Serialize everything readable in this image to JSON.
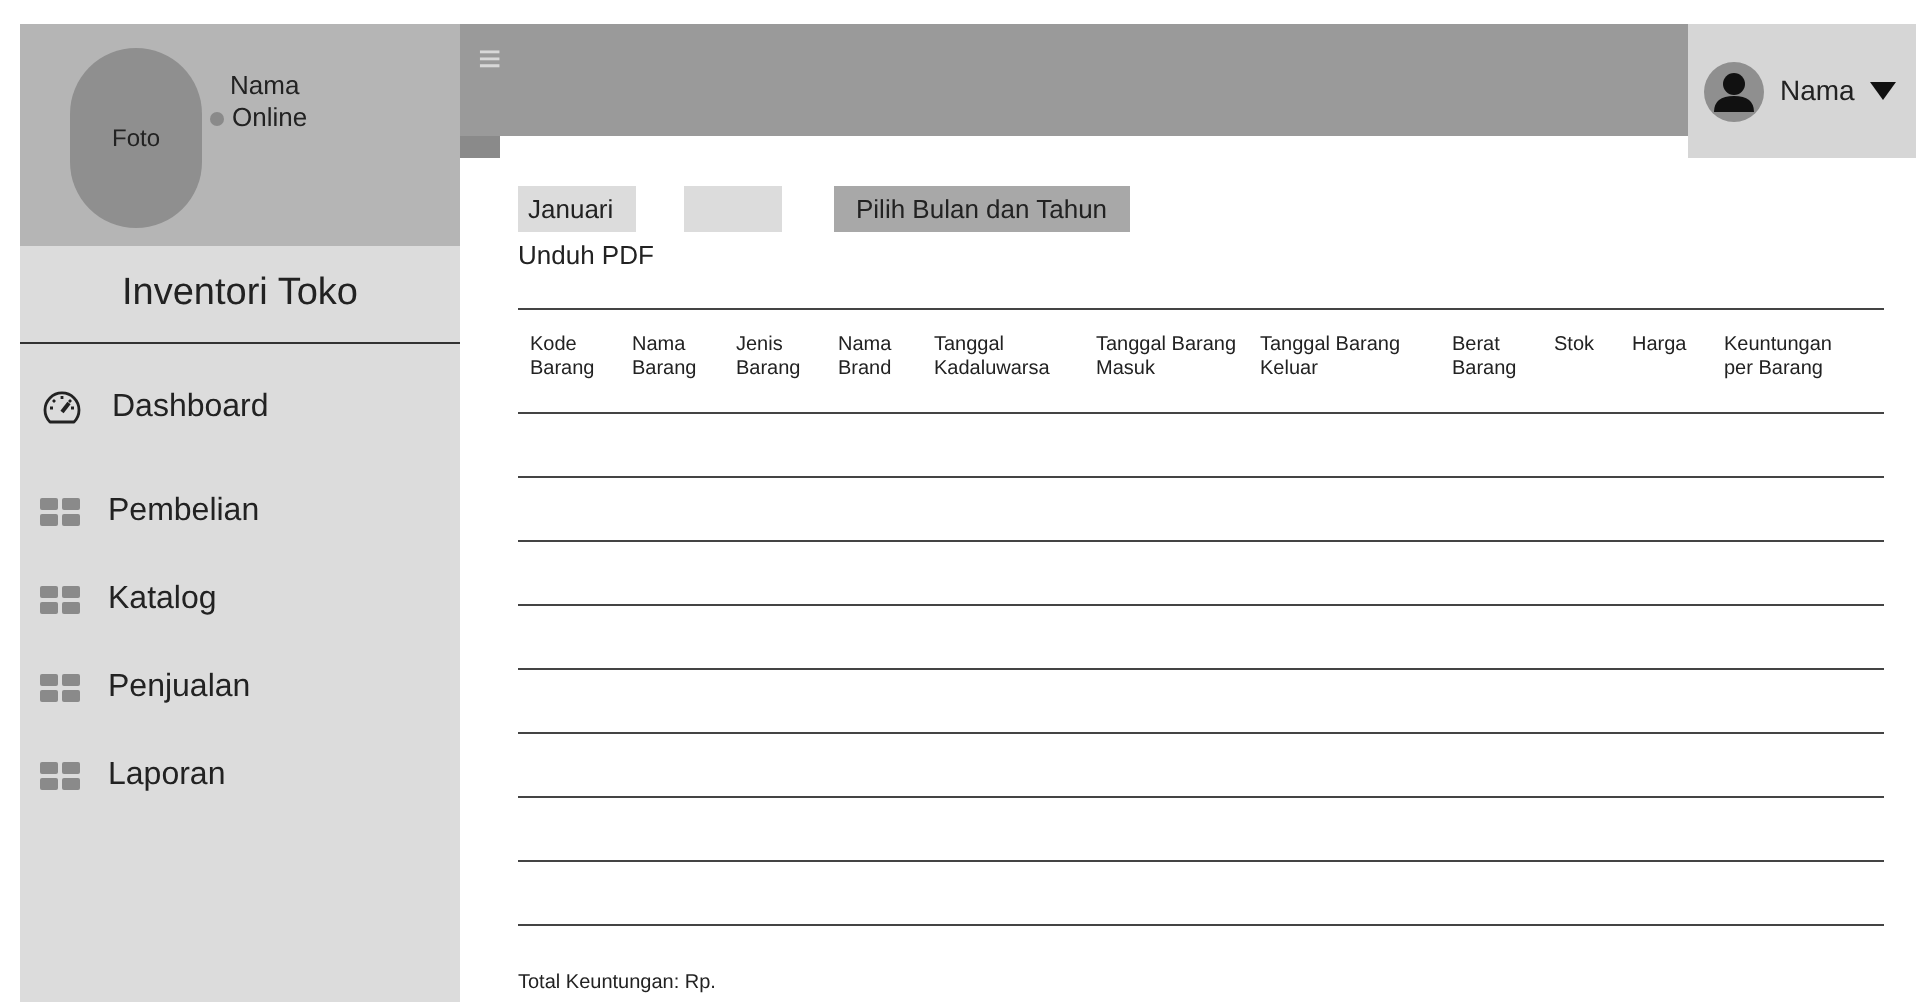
{
  "profile": {
    "photo_label": "Foto",
    "name": "Nama",
    "status": "Online"
  },
  "app_title": "Inventori Toko",
  "sidebar": {
    "items": [
      {
        "label": "Dashboard",
        "kind": "gauge"
      },
      {
        "label": "Pembelian",
        "kind": "grid"
      },
      {
        "label": "Katalog",
        "kind": "grid"
      },
      {
        "label": "Penjualan",
        "kind": "grid"
      },
      {
        "label": "Laporan",
        "kind": "grid"
      }
    ]
  },
  "topbar": {
    "menu_icon": "≡",
    "user_name": "Nama"
  },
  "filters": {
    "month": "Januari",
    "submit": "Pilih Bulan dan Tahun",
    "download": "Unduh PDF"
  },
  "table": {
    "columns": [
      [
        "Kode",
        "Barang"
      ],
      [
        "Nama",
        "Barang"
      ],
      [
        "Jenis",
        "Barang"
      ],
      [
        "Nama",
        "Brand"
      ],
      [
        "Tanggal",
        "Kadaluwarsa"
      ],
      [
        "Tanggal Barang",
        "Masuk"
      ],
      [
        "Tanggal Barang",
        "Keluar"
      ],
      [
        "Berat",
        "Barang"
      ],
      [
        "Stok"
      ],
      [
        "Harga"
      ],
      [
        "Keuntungan",
        "per Barang"
      ]
    ]
  },
  "total": "Total Keuntungan: Rp."
}
